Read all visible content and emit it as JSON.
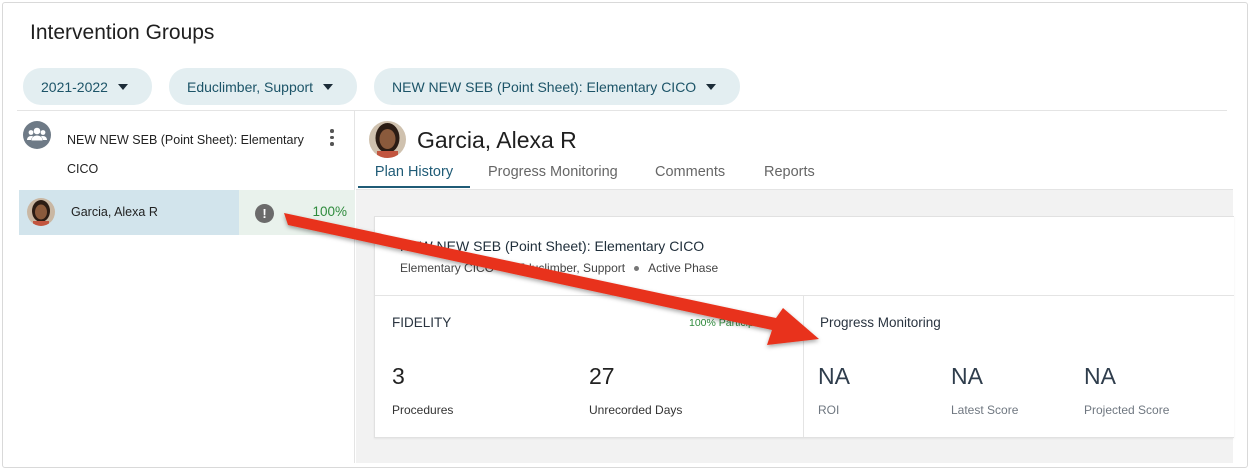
{
  "page": {
    "title": "Intervention Groups"
  },
  "filters": [
    {
      "label": "2021-2022"
    },
    {
      "label": "Educlimber, Support"
    },
    {
      "label": "NEW NEW SEB (Point Sheet): Elementary CICO"
    }
  ],
  "sidebar": {
    "group_name": "NEW NEW SEB (Point Sheet): Elementary CICO",
    "student": {
      "name": "Garcia, Alexa R",
      "warning": "!",
      "percent": "100%"
    }
  },
  "student_header": {
    "name": "Garcia, Alexa R"
  },
  "tabs": [
    {
      "label": "Plan History",
      "active": true
    },
    {
      "label": "Progress Monitoring",
      "active": false
    },
    {
      "label": "Comments",
      "active": false
    },
    {
      "label": "Reports",
      "active": false
    }
  ],
  "plan": {
    "title": "NEW NEW SEB (Point Sheet): Elementary CICO",
    "meta": [
      "Elementary CICO",
      "Educlimber, Support",
      "Active Phase"
    ]
  },
  "fidelity": {
    "label": "FIDELITY",
    "participation": "100% Participation",
    "procedures": {
      "value": "3",
      "label": "Procedures"
    },
    "unrecorded": {
      "value": "27",
      "label": "Unrecorded Days"
    }
  },
  "progress_monitoring": {
    "label": "Progress Monitoring",
    "roi": {
      "value": "NA",
      "label": "ROI"
    },
    "latest": {
      "value": "NA",
      "label": "Latest Score"
    },
    "projected": {
      "value": "NA",
      "label": "Projected Score"
    }
  },
  "colors": {
    "accent": "#1f5b76",
    "pill_bg": "#e3eef1",
    "selected_row": "#d2e4ec",
    "success": "#2e8b3c",
    "annotation_arrow": "#e8321c"
  }
}
